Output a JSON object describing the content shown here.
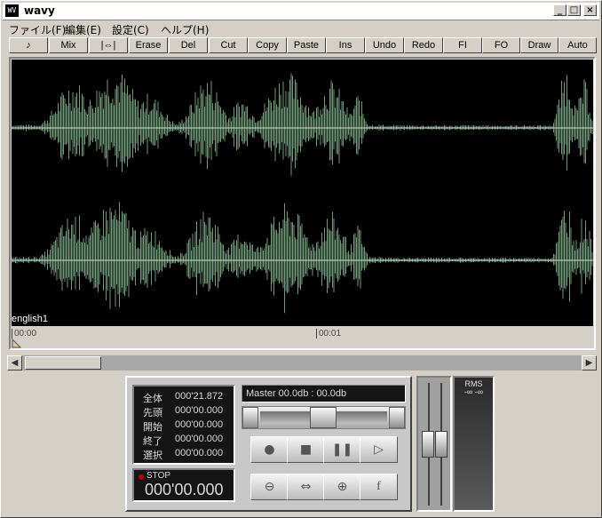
{
  "window": {
    "title": "wavy",
    "icon_label": "WV",
    "controls": {
      "minimize": "_",
      "maximize": "□",
      "close": "×"
    }
  },
  "menu": [
    "ファイル(F)",
    "編集(E)",
    "設定(C)",
    "ヘルプ(H)"
  ],
  "toolbar": [
    "♪",
    "Mix",
    "|⇔|",
    "Erase",
    "Del",
    "Cut",
    "Copy",
    "Paste",
    "Ins",
    "Undo",
    "Redo",
    "FI",
    "FO",
    "Draw",
    "Auto"
  ],
  "waveform": {
    "track_label": "english1",
    "time_marks": [
      "00:00",
      "00:01"
    ],
    "wave_color": "#6e9a78",
    "background": "#000000"
  },
  "scrollbar": {
    "left_arrow": "◀",
    "right_arrow": "▶"
  },
  "transport": {
    "info": [
      {
        "label": "全体",
        "value": "000'21.872"
      },
      {
        "label": "先頭",
        "value": "000'00.000"
      },
      {
        "label": "開始",
        "value": "000'00.000"
      },
      {
        "label": "終了",
        "value": "000'00.000"
      },
      {
        "label": "選択",
        "value": "000'00.000"
      }
    ],
    "status": "STOP",
    "counter": "000'00.000",
    "master": "Master 00.0db : 00.0db",
    "buttons_row1": [
      "●",
      "■",
      "❚❚",
      "▷"
    ],
    "buttons_row2": [
      "⊖",
      "⇔",
      "⊕",
      "f"
    ],
    "meter_label": "RMS",
    "meter_values": "-∞ -∞"
  }
}
